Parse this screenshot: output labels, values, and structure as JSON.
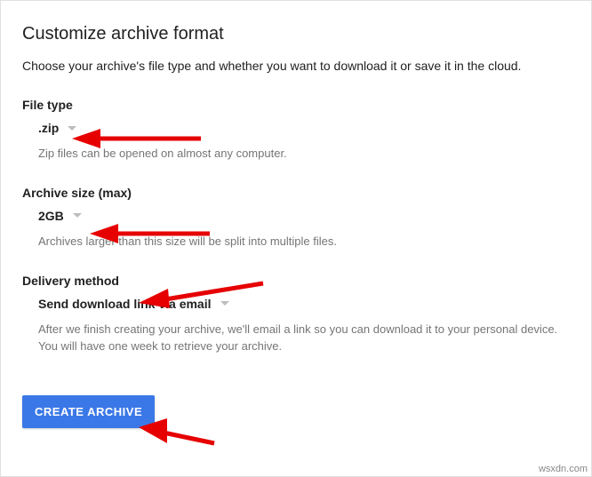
{
  "title": "Customize archive format",
  "description": "Choose your archive's file type and whether you want to download it or save it in the cloud.",
  "file_type": {
    "label": "File type",
    "value": ".zip",
    "helper": "Zip files can be opened on almost any computer."
  },
  "archive_size": {
    "label": "Archive size (max)",
    "value": "2GB",
    "helper": "Archives larger than this size will be split into multiple files."
  },
  "delivery_method": {
    "label": "Delivery method",
    "value": "Send download link via email",
    "helper": "After we finish creating your archive, we'll email a link so you can download it to your personal device. You will have one week to retrieve your archive."
  },
  "create_button": "CREATE ARCHIVE",
  "watermark": "wsxdn.com"
}
